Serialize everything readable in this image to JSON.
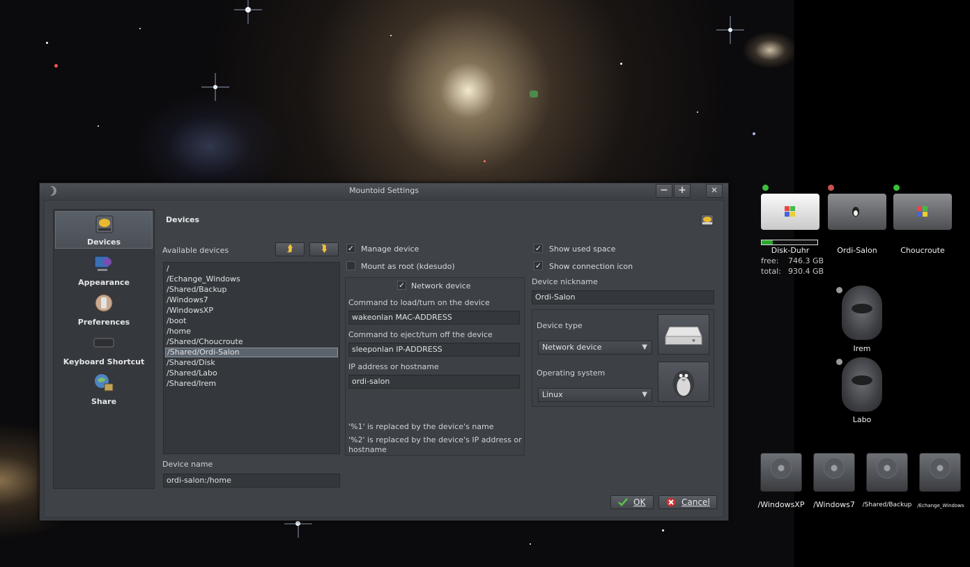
{
  "window": {
    "title": "Mountoid Settings",
    "minimize_symbol": "−",
    "maximize_symbol": "+",
    "close_symbol": "✕"
  },
  "sidebar": {
    "items": [
      {
        "label": "Devices",
        "icon": "hard-drive-icon",
        "active": true
      },
      {
        "label": "Appearance",
        "icon": "appearance-icon",
        "active": false
      },
      {
        "label": "Preferences",
        "icon": "preferences-icon",
        "active": false
      },
      {
        "label": "Keyboard Shortcut",
        "icon": "keyboard-icon",
        "active": false
      },
      {
        "label": "Share",
        "icon": "share-icon",
        "active": false
      }
    ]
  },
  "section": {
    "title": "Devices"
  },
  "available": {
    "label": "Available devices",
    "move_up_symbol": "⮭",
    "move_down_symbol": "⮯",
    "items": [
      "/",
      "/Echange_Windows",
      "/Shared/Backup",
      "/Windows7",
      "/WindowsXP",
      "/boot",
      "/home",
      "/Shared/Choucroute",
      "/Shared/Ordi-Salon",
      "/Shared/Disk",
      "/Shared/Labo",
      "/Shared/Irem"
    ],
    "selected": "/Shared/Ordi-Salon"
  },
  "device_name": {
    "label": "Device name",
    "value": "ordi-salon:/home"
  },
  "options": {
    "manage_device": {
      "label": "Manage device",
      "checked": true
    },
    "mount_as_root": {
      "label": "Mount as root (kdesudo)",
      "checked": false
    },
    "network_device": {
      "label": "Network device",
      "checked": true
    },
    "show_used_space": {
      "label": "Show used space",
      "checked": true
    },
    "show_connection_icon": {
      "label": "Show connection icon",
      "checked": true
    }
  },
  "network": {
    "load_label": "Command to load/turn on the device",
    "load_value": "wakeonlan MAC-ADDRESS",
    "eject_label": "Command to eject/turn off the device",
    "eject_value": "sleeponlan IP-ADDRESS",
    "host_label": "IP address or hostname",
    "host_value": "ordi-salon",
    "note1": "'%1' is replaced by the device's name",
    "note2_line1": "'%2' is replaced by the device's IP address or",
    "note2_line2": "hostname"
  },
  "nickname": {
    "label": "Device nickname",
    "value": "Ordi-Salon"
  },
  "device_type": {
    "label": "Device type",
    "value": "Network device"
  },
  "os": {
    "label": "Operating system",
    "value": "Linux"
  },
  "buttons": {
    "ok": "OK",
    "cancel": "Cancel"
  },
  "desktop": {
    "drives": [
      {
        "name": "Disk-Duhr",
        "led": "#3bbf3b",
        "free_label": "free:",
        "free_value": "746.3 GB",
        "total_label": "total:",
        "total_value": "930.4 GB",
        "usage_fraction": 0.2
      },
      {
        "name": "Ordi-Salon",
        "led": "#c85050"
      },
      {
        "name": "Choucroute",
        "led": "#3bbf3b"
      }
    ],
    "remote": [
      {
        "name": "Irem"
      },
      {
        "name": "Labo"
      }
    ],
    "disks": [
      {
        "name": "/WindowsXP"
      },
      {
        "name": "/Windows7"
      },
      {
        "name": "/Shared/Backup"
      },
      {
        "name": "/Echange_Windows"
      }
    ]
  },
  "colors": {
    "accent": "#5b636d",
    "led_on": "#3bbf3b",
    "led_off": "#c85050"
  }
}
